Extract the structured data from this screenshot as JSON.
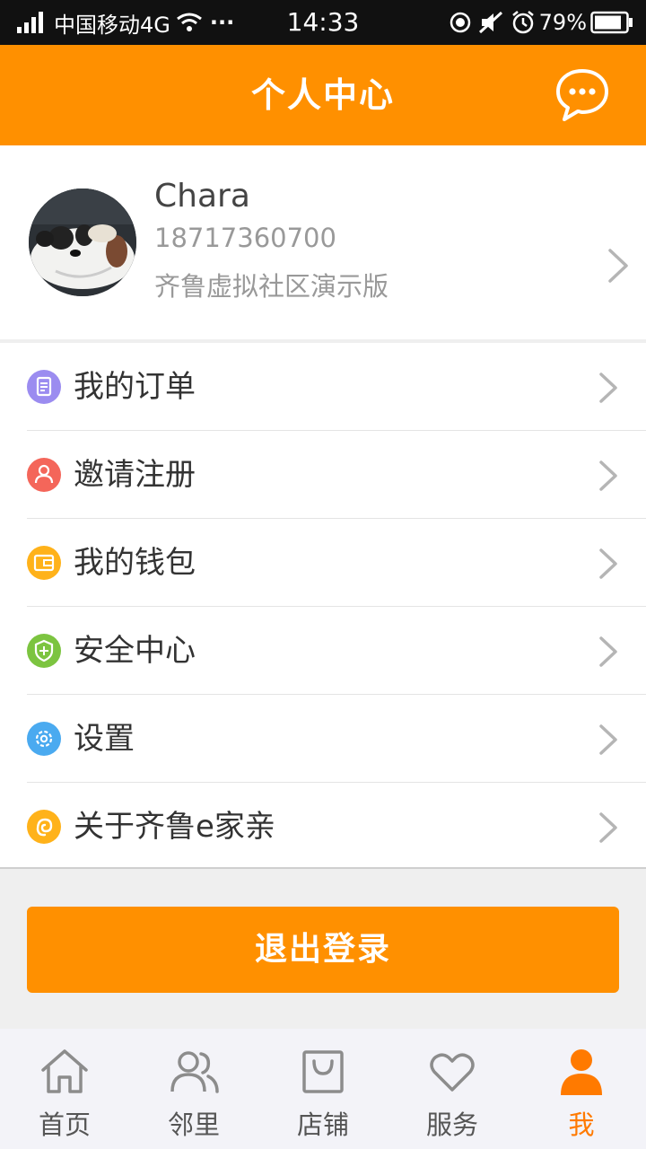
{
  "status_bar": {
    "carrier": "中国移动4G",
    "dots": "···",
    "time": "14:33",
    "battery": "79%"
  },
  "header": {
    "title": "个人中心",
    "message_icon": "chat-bubble-icon"
  },
  "profile": {
    "name": "Chara",
    "phone": "18717360700",
    "community": "齐鲁虚拟社区演示版"
  },
  "menu": [
    {
      "label": "我的订单",
      "icon": "order-icon",
      "color": "#9b8cf0"
    },
    {
      "label": "邀请注册",
      "icon": "person-icon",
      "color": "#f4665a"
    },
    {
      "label": "我的钱包",
      "icon": "wallet-icon",
      "color": "#ffb21a"
    },
    {
      "label": "安全中心",
      "icon": "shield-icon",
      "color": "#7cc440"
    },
    {
      "label": "设置",
      "icon": "gear-icon",
      "color": "#4aaaf0"
    },
    {
      "label": "关于齐鲁e家亲",
      "icon": "app-logo-icon",
      "color": "#ffb21a"
    }
  ],
  "logout_label": "退出登录",
  "nav": [
    {
      "label": "首页",
      "icon": "home-icon"
    },
    {
      "label": "邻里",
      "icon": "neighbors-icon"
    },
    {
      "label": "店铺",
      "icon": "shop-icon"
    },
    {
      "label": "服务",
      "icon": "heart-icon"
    },
    {
      "label": "我",
      "icon": "me-icon",
      "active": true
    }
  ],
  "colors": {
    "accent": "#ff9000",
    "active_nav": "#ff7a00"
  }
}
